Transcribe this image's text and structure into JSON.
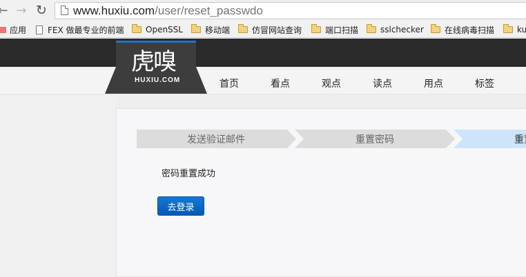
{
  "browser": {
    "url_host": "www.huxiu.com",
    "url_path": "/user/reset_passwdo"
  },
  "bookmarks": [
    {
      "label": "应用",
      "icon": "apps-icon"
    },
    {
      "label": "FEX 做最专业的前端",
      "icon": "page-icon"
    },
    {
      "label": "OpenSSL",
      "icon": "folder-icon"
    },
    {
      "label": "移动端",
      "icon": "folder-icon"
    },
    {
      "label": "仿冒网站查询",
      "icon": "folder-icon"
    },
    {
      "label": "端口扫描",
      "icon": "folder-icon"
    },
    {
      "label": "sslchecker",
      "icon": "folder-icon"
    },
    {
      "label": "在线病毒扫描",
      "icon": "folder-icon"
    },
    {
      "label": "ku",
      "icon": "folder-icon"
    }
  ],
  "site": {
    "logo_main": "虎嗅",
    "logo_sub": "HUXIU.COM",
    "nav": [
      "首页",
      "看点",
      "观点",
      "读点",
      "用点",
      "标签"
    ]
  },
  "steps": [
    "发送验证邮件",
    "重置密码",
    "重置"
  ],
  "colors": {
    "step_inactive": "#dcdcdc",
    "step_active": "#cde4fb",
    "button": "#0a68c8"
  },
  "result": {
    "message": "密码重置成功",
    "login_button": "去登录"
  }
}
